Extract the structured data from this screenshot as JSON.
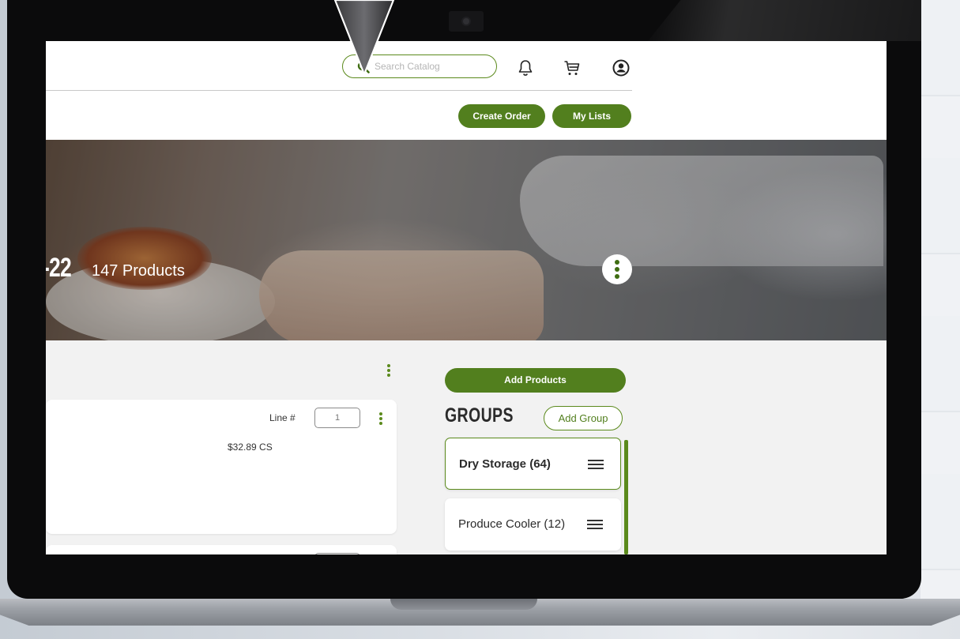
{
  "header": {
    "search": {
      "placeholder": "Search Catalog"
    },
    "icons": [
      "search-icon",
      "bell-icon",
      "cart-icon",
      "user-icon"
    ],
    "buttons": {
      "create_order": "Create Order",
      "my_lists": "My Lists"
    }
  },
  "hero": {
    "list_name_fragment": "-22",
    "product_count": "147 Products"
  },
  "products": {
    "first_card": {
      "line_label": "Line #",
      "line_value": "1",
      "price": "$32.89 CS"
    }
  },
  "sidebar": {
    "add_products_label": "Add Products",
    "groups_heading": "GROUPS",
    "add_group_label": "Add Group",
    "groups": [
      {
        "label": "Dry Storage (64)",
        "active": true
      },
      {
        "label": "Produce Cooler (12)",
        "active": false
      }
    ]
  },
  "colors": {
    "brand_green": "#527f1e",
    "outline_green": "#5b8a1c",
    "bezel": "#0b0b0c",
    "page_bg": "#f2f2f2"
  }
}
